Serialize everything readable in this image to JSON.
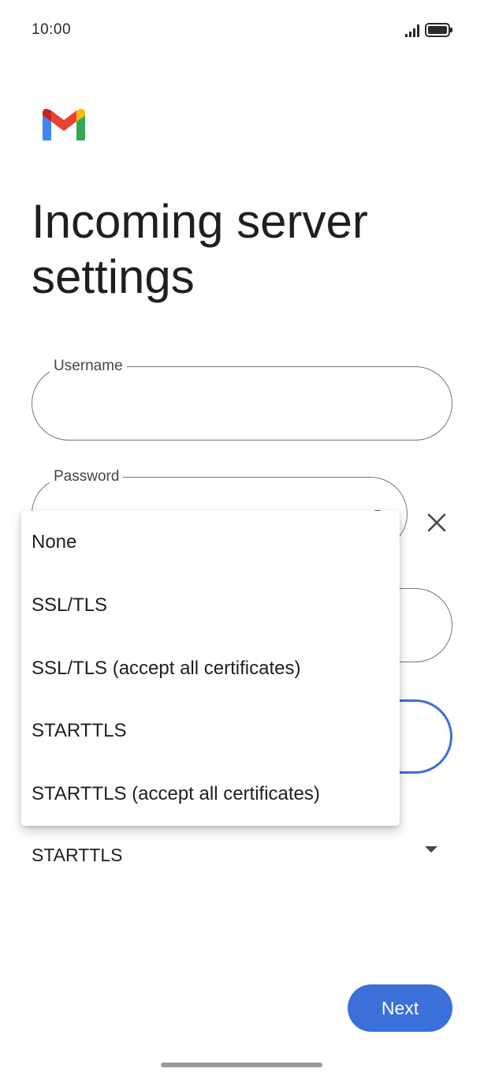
{
  "status_bar": {
    "time": "10:00",
    "icons": [
      "signal-icon",
      "battery-icon"
    ]
  },
  "app": {
    "logo": "gmail-logo",
    "title": "Incoming server settings"
  },
  "form": {
    "username": {
      "label": "Username",
      "value": ""
    },
    "password": {
      "label": "Password",
      "value": ""
    },
    "security_type": {
      "value": "STARTTLS"
    }
  },
  "security_menu": {
    "items": [
      "None",
      "SSL/TLS",
      "SSL/TLS (accept all certificates)",
      "STARTTLS",
      "STARTTLS (accept all certificates)"
    ]
  },
  "actions": {
    "next_label": "Next"
  },
  "colors": {
    "accent": "#3b6fd9",
    "outline": "#747775",
    "text": "#1f1f1f"
  }
}
